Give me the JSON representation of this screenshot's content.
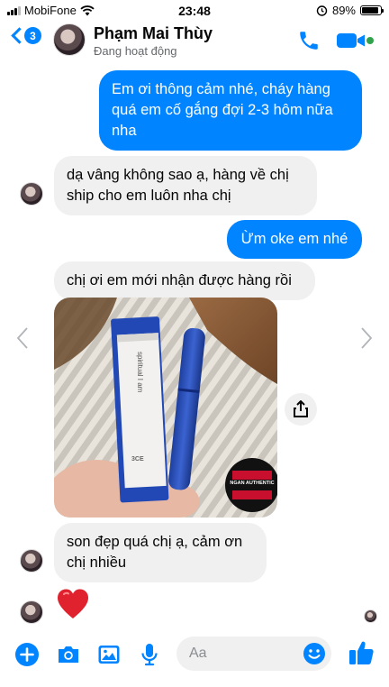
{
  "status_bar": {
    "carrier": "MobiFone",
    "time": "23:48",
    "battery": "89%",
    "battery_level": 0.89,
    "icons": [
      "signal-icon",
      "wifi-icon",
      "alarm-icon",
      "battery-icon"
    ]
  },
  "header": {
    "back_badge": "3",
    "contact_name": "Phạm Mai Thùy",
    "contact_status": "Đang hoạt động",
    "accent_color": "#0084ff",
    "online_color": "#31a24c",
    "icons": [
      "back-chevron-icon",
      "phone-icon",
      "video-camera-icon",
      "online-dot-icon"
    ]
  },
  "messages": [
    {
      "direction": "outgoing",
      "text": "Em ơi thông cảm nhé, cháy hàng quá em cố gắng đợi 2-3 hôm nữa nha"
    },
    {
      "direction": "incoming",
      "text": "dạ vâng không sao ạ, hàng về chị ship cho em luôn nha chị"
    },
    {
      "direction": "outgoing",
      "text": "Ừm oke em nhé"
    },
    {
      "direction": "incoming",
      "text": "chị ơi em mới nhận được hàng rồi"
    },
    {
      "direction": "incoming",
      "type": "photo",
      "photo": {
        "box_brand": "3CE",
        "box_text": "spiritual I am",
        "logo_text": "NGAN AUTHENTIC"
      }
    },
    {
      "direction": "incoming",
      "text": "son đẹp quá chị ạ, cảm ơn chị nhiều"
    },
    {
      "direction": "incoming",
      "type": "sticker",
      "emoji": "❤️"
    }
  ],
  "bubble_colors": {
    "outgoing": "#0084ff",
    "incoming": "#f0f0f0"
  },
  "composer": {
    "placeholder": "Aa",
    "icons": [
      "plus-icon",
      "camera-icon",
      "image-icon",
      "microphone-icon",
      "emoji-icon",
      "thumbs-up-icon"
    ]
  }
}
